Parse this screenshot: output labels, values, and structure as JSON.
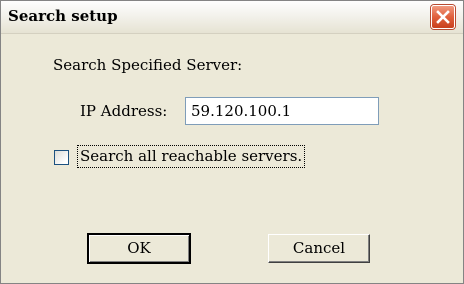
{
  "window": {
    "title": "Search setup",
    "close_icon": "close-icon"
  },
  "form": {
    "server_label": "Search Specified Server:",
    "ip_label": "IP Address:",
    "ip_value": "59.120.100.1",
    "checkbox_label": "Search all reachable servers.",
    "checkbox_checked": false
  },
  "buttons": {
    "ok_label": "OK",
    "cancel_label": "Cancel"
  },
  "colors": {
    "dialog_bg": "#ece9d8",
    "close_button": "#e0603c"
  }
}
